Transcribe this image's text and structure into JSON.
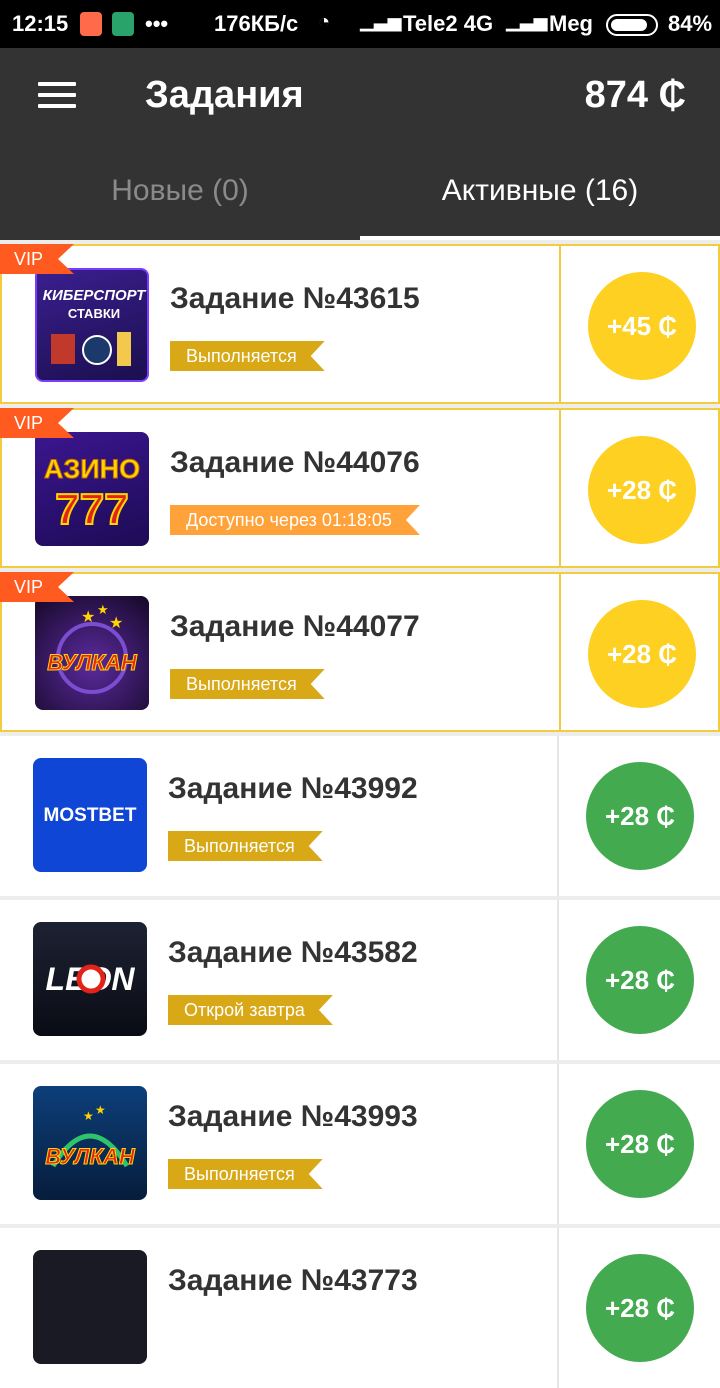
{
  "status_bar": {
    "time": "12:15",
    "speed": "176КБ/с",
    "carrier1": "Tele2 4G",
    "carrier2": "Meg",
    "battery": "84%"
  },
  "header": {
    "title": "Задания",
    "balance": "874 ₵"
  },
  "tabs": [
    {
      "label": "Новые (0)"
    },
    {
      "label": "Активные (16)"
    }
  ],
  "colors": {
    "appbar": "#333333",
    "vip_border": "#f2cb3f",
    "reward_gold": "#fdd022",
    "reward_green": "#44aa50",
    "badge_yellow": "#d8a816",
    "badge_orange": "#ffa23a",
    "vip_tag": "#ff5a1f"
  },
  "tasks": [
    {
      "vip": "VIP",
      "logo_text": "КИБЕРСПОРТ СТАВКИ",
      "title": "Задание №43615",
      "status": "Выполняется",
      "reward": "+45 ₵"
    },
    {
      "vip": "VIP",
      "logo_text": "АЗИНО 777",
      "title": "Задание №44076",
      "status": "Доступно через 01:18:05",
      "reward": "+28 ₵"
    },
    {
      "vip": "VIP",
      "logo_text": "ВУЛКАН",
      "title": "Задание №44077",
      "status": "Выполняется",
      "reward": "+28 ₵"
    },
    {
      "logo_text": "MOSTBET",
      "title": "Задание №43992",
      "status": "Выполняется",
      "reward": "+28 ₵"
    },
    {
      "logo_text": "LEON",
      "title": "Задание №43582",
      "status": "Открой завтра",
      "reward": "+28 ₵"
    },
    {
      "logo_text": "ВУЛКАН",
      "title": "Задание №43993",
      "status": "Выполняется",
      "reward": "+28 ₵"
    },
    {
      "title": "Задание №43773",
      "reward": "+28 ₵"
    }
  ]
}
